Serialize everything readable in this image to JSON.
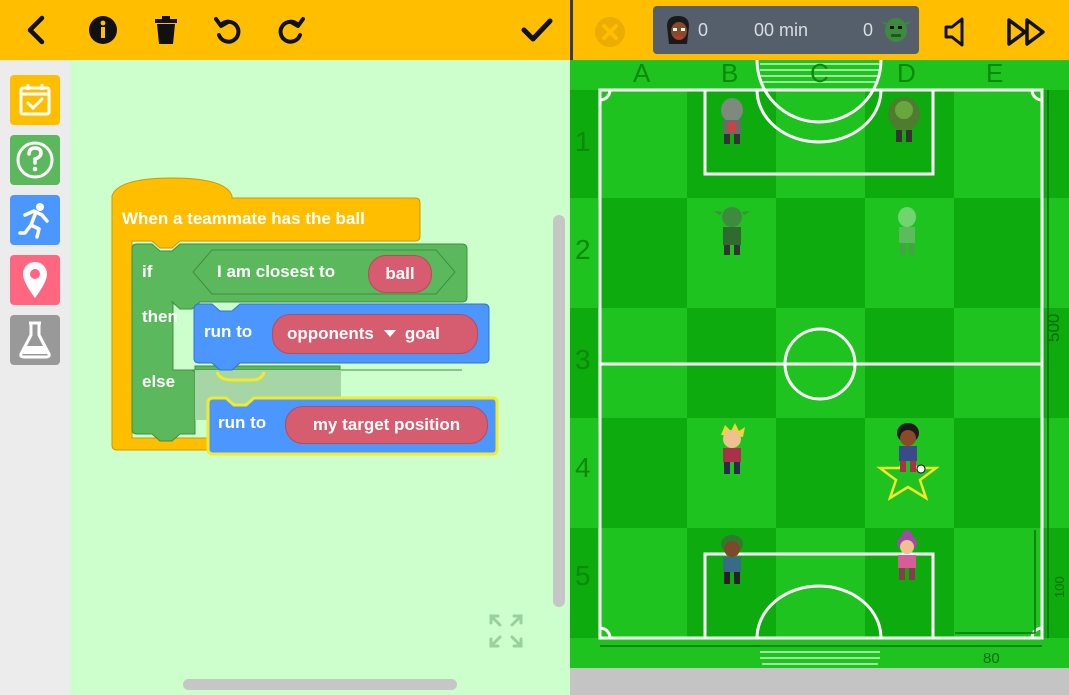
{
  "toolbar": {
    "back_icon": "chevron-left-icon",
    "info_icon": "info-icon",
    "delete_icon": "trash-icon",
    "undo_icon": "undo-icon",
    "redo_icon": "redo-icon",
    "confirm_icon": "checkmark-icon"
  },
  "game_toolbar": {
    "close_icon": "close-icon",
    "left_score": "0",
    "time": "00 min",
    "right_score": "0",
    "sound_icon": "speaker-icon",
    "speed_icon": "fast-forward-icon"
  },
  "sidebar": {
    "categories": [
      {
        "name": "events",
        "icon": "calendar-check-icon",
        "color": "#ffbf00"
      },
      {
        "name": "ball",
        "icon": "soccer-ball-question-icon",
        "color": "#5cb85c"
      },
      {
        "name": "actions",
        "icon": "running-person-icon",
        "color": "#4c97ff"
      },
      {
        "name": "positions",
        "icon": "location-pin-icon",
        "color": "#ff6680"
      },
      {
        "name": "experimental",
        "icon": "flask-icon",
        "color": "#999999"
      }
    ]
  },
  "blocks": {
    "event_label": "When a teammate has the ball",
    "if_label": "if",
    "condition_label": "I am closest to",
    "condition_value": "ball",
    "then_label": "then",
    "run_to_label": "run to",
    "target1_value": "opponents",
    "target1_suffix": "goal",
    "else_label": "else",
    "run_to2_label": "run to",
    "target2_value": "my target position"
  },
  "field": {
    "columns": [
      "A",
      "B",
      "C",
      "D",
      "E"
    ],
    "rows": [
      "1",
      "2",
      "3",
      "4",
      "5"
    ],
    "side_measure": "500",
    "side_measure_small": "100",
    "bottom_measure": "80"
  },
  "colors": {
    "toolbar": "#ffbf00",
    "workspace": "#ccffcc",
    "event_block": "#ffbf00",
    "logic_block": "#5cb85c",
    "motion_block": "#4c97ff",
    "reporter_pill": "#d65c70",
    "field_green": "#1fc31f"
  }
}
